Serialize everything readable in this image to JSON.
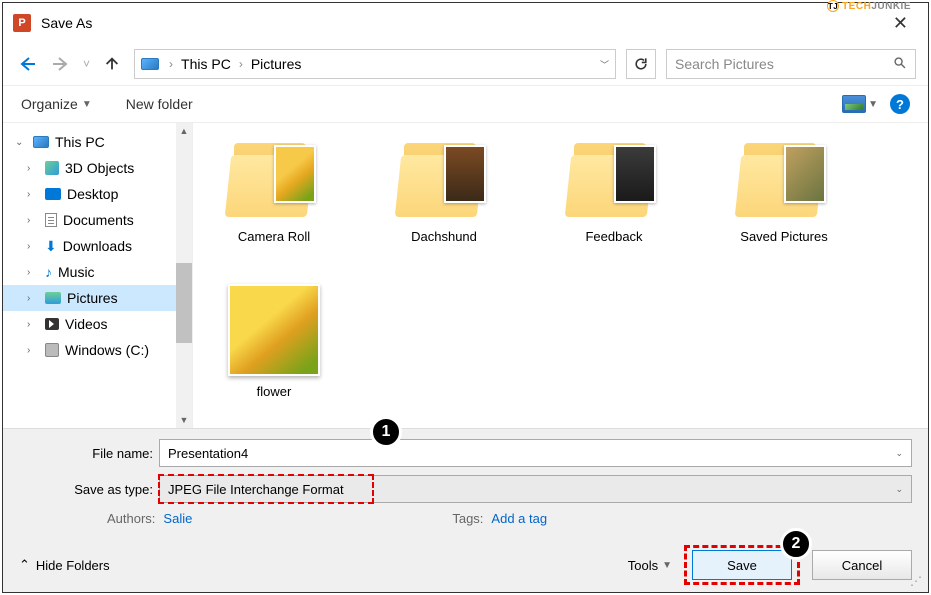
{
  "watermark": {
    "text1": "TECH",
    "text2": "JUNKIE"
  },
  "titlebar": {
    "icon_letter": "P",
    "title": "Save As"
  },
  "nav": {
    "breadcrumb1": "This PC",
    "breadcrumb2": "Pictures",
    "search_placeholder": "Search Pictures"
  },
  "cmd": {
    "organize": "Organize",
    "newfolder": "New folder",
    "help_glyph": "?"
  },
  "tree": {
    "items": [
      {
        "label": "This PC"
      },
      {
        "label": "3D Objects"
      },
      {
        "label": "Desktop"
      },
      {
        "label": "Documents"
      },
      {
        "label": "Downloads"
      },
      {
        "label": "Music"
      },
      {
        "label": "Pictures"
      },
      {
        "label": "Videos"
      },
      {
        "label": "Windows (C:)"
      }
    ]
  },
  "content": {
    "items": [
      {
        "label": "Camera Roll"
      },
      {
        "label": "Dachshund"
      },
      {
        "label": "Feedback"
      },
      {
        "label": "Saved Pictures"
      },
      {
        "label": "flower"
      }
    ]
  },
  "form": {
    "filename_label": "File name:",
    "filename_value": "Presentation4",
    "savetype_label": "Save as type:",
    "savetype_value": "JPEG File Interchange Format",
    "authors_label": "Authors:",
    "authors_value": "Salie",
    "tags_label": "Tags:",
    "tags_value": "Add a tag"
  },
  "footer": {
    "hidefolders": "Hide Folders",
    "tools": "Tools",
    "save": "Save",
    "cancel": "Cancel"
  },
  "callouts": {
    "c1": "1",
    "c2": "2"
  }
}
